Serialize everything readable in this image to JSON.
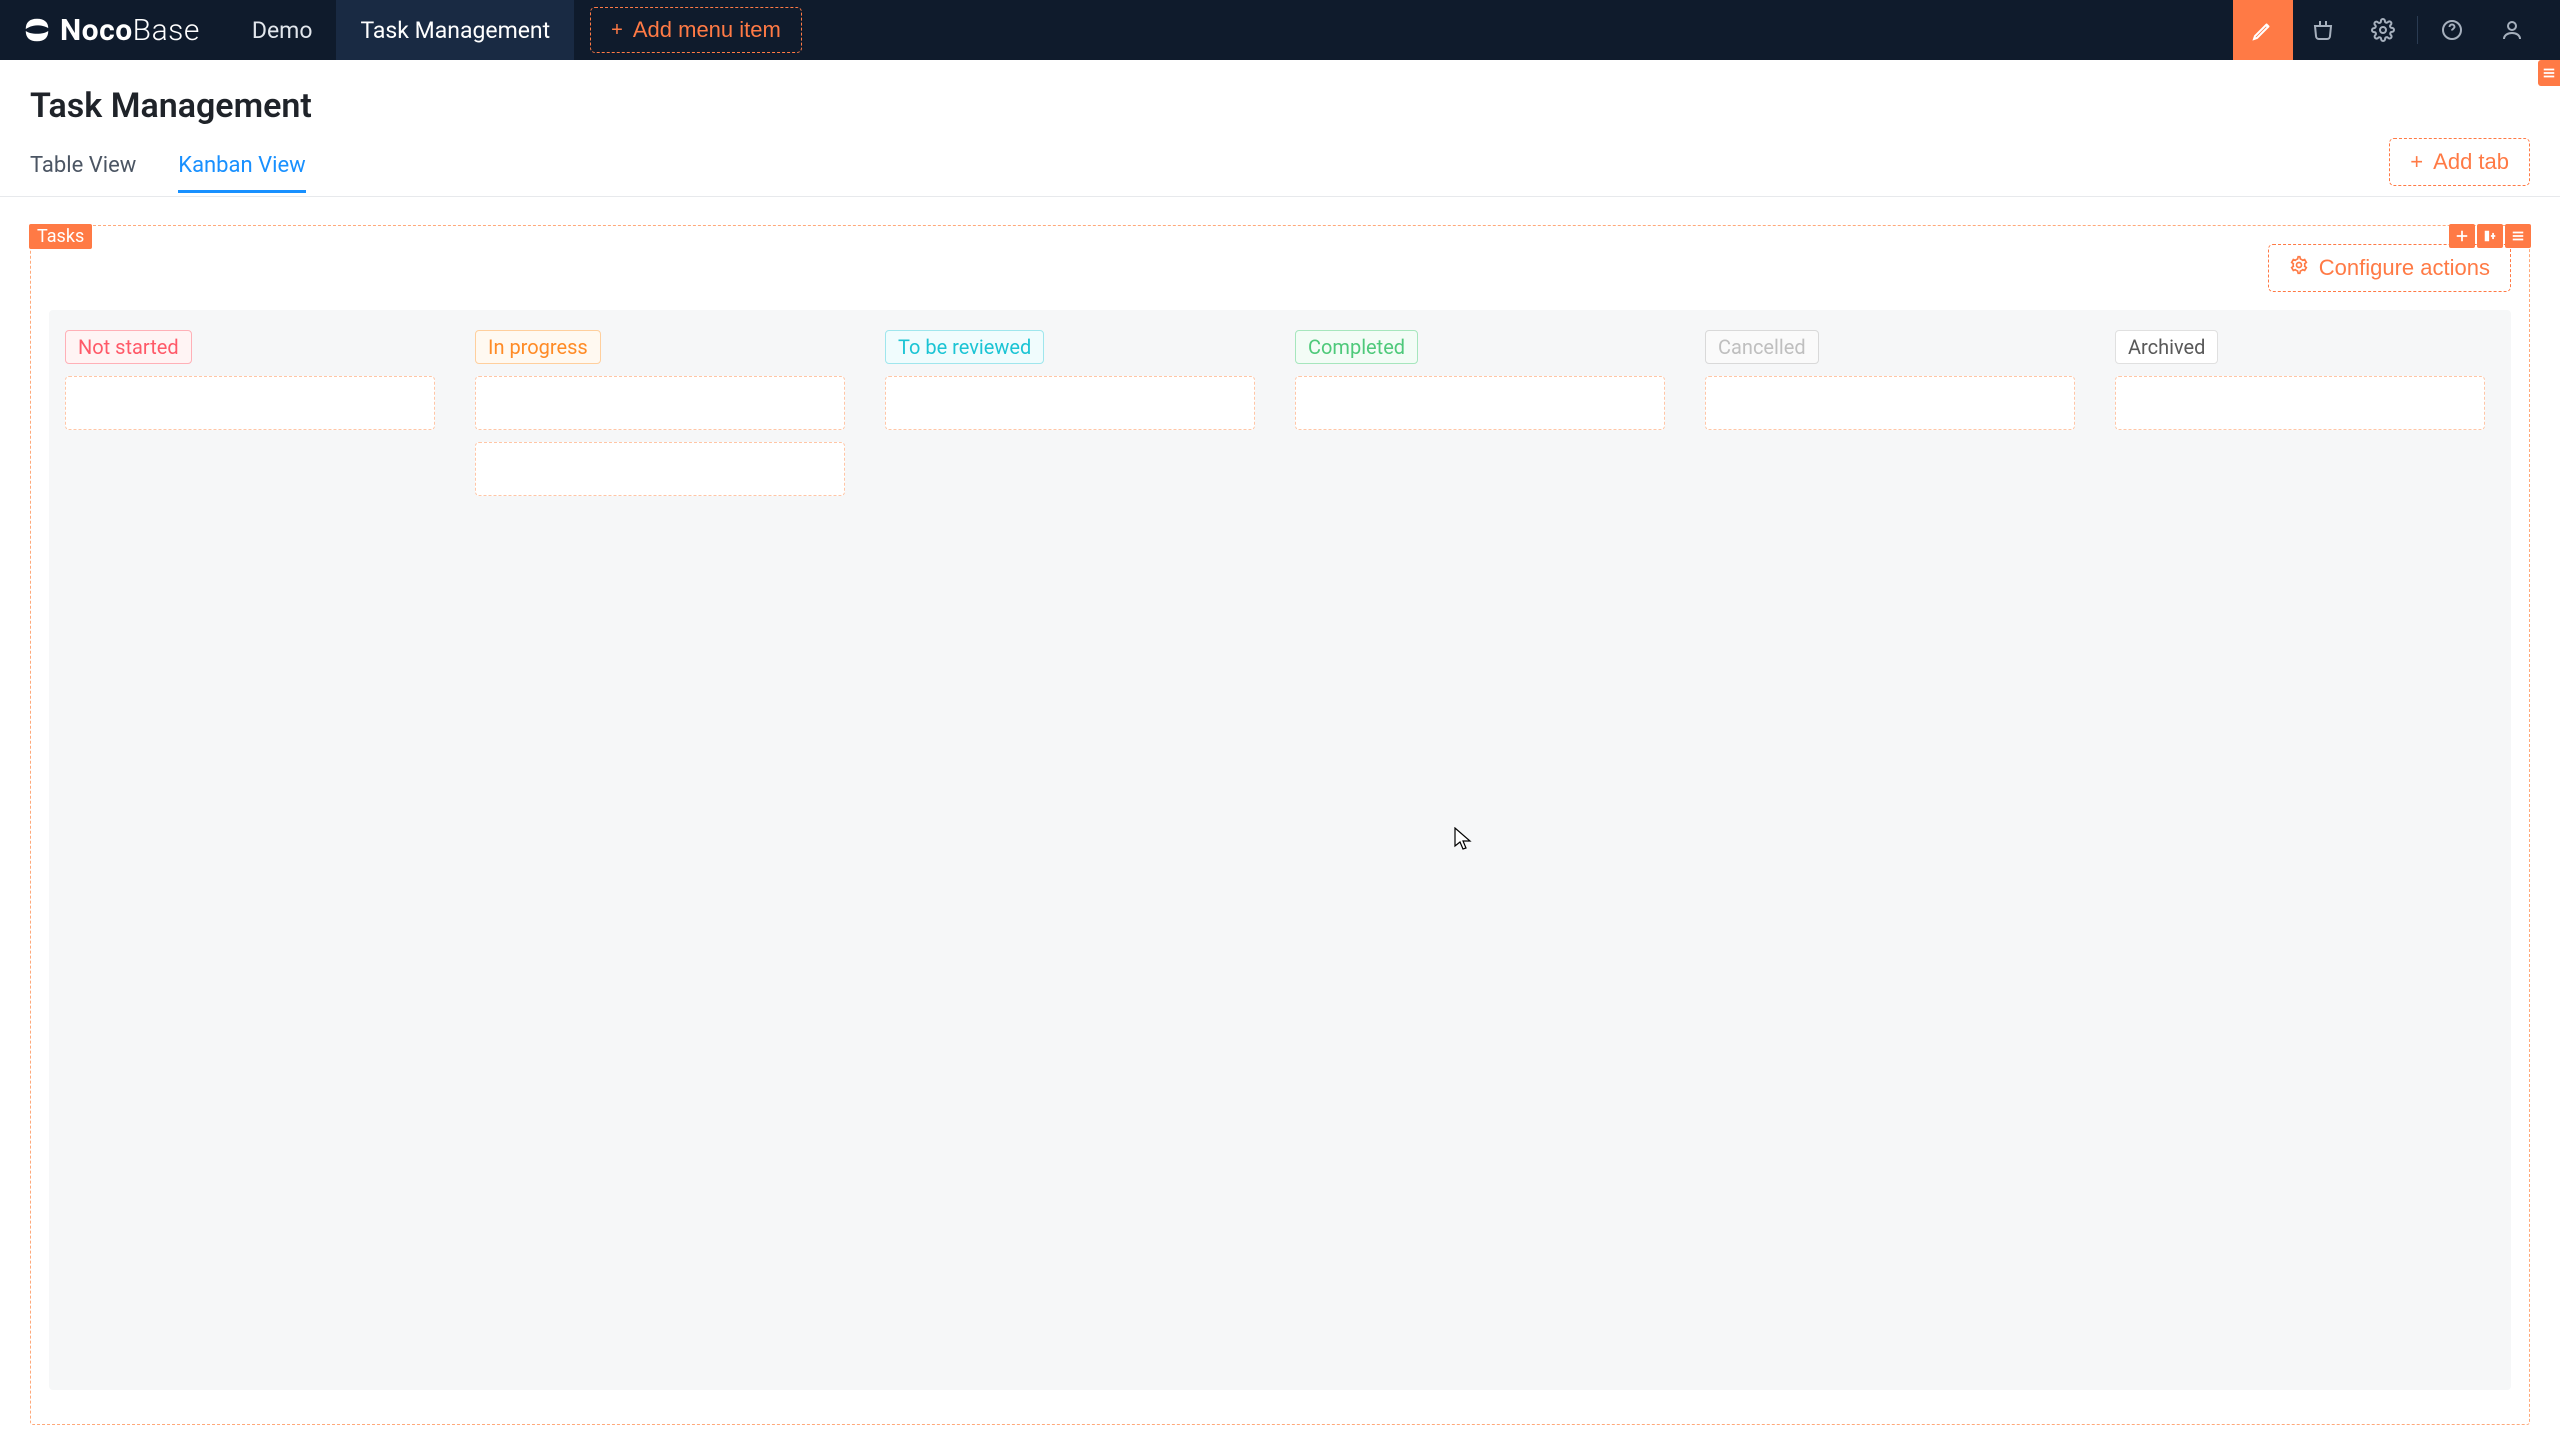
{
  "brand": {
    "name_bold": "Noco",
    "name_light": "Base"
  },
  "nav": {
    "items": [
      {
        "label": "Demo",
        "active": false
      },
      {
        "label": "Task Management",
        "active": true
      }
    ],
    "add_menu_label": "Add menu item"
  },
  "page": {
    "title": "Task Management"
  },
  "tabs": {
    "items": [
      {
        "label": "Table View",
        "active": false
      },
      {
        "label": "Kanban View",
        "active": true
      }
    ],
    "add_tab_label": "Add tab"
  },
  "block": {
    "tag": "Tasks",
    "configure_actions_label": "Configure actions"
  },
  "kanban": {
    "columns": [
      {
        "key": "notstarted",
        "label": "Not started",
        "chip_class": "chip-notstarted",
        "cards": 1
      },
      {
        "key": "inprogress",
        "label": "In progress",
        "chip_class": "chip-inprogress",
        "cards": 2
      },
      {
        "key": "tobereviewed",
        "label": "To be reviewed",
        "chip_class": "chip-tobereviewed",
        "cards": 1
      },
      {
        "key": "completed",
        "label": "Completed",
        "chip_class": "chip-completed",
        "cards": 1
      },
      {
        "key": "cancelled",
        "label": "Cancelled",
        "chip_class": "chip-cancelled",
        "cards": 1
      },
      {
        "key": "archived",
        "label": "Archived",
        "chip_class": "chip-archived",
        "cards": 1
      }
    ]
  },
  "colors": {
    "accent": "#ff7a45",
    "link": "#1890ff",
    "navbar_bg": "#0f1b2c"
  }
}
